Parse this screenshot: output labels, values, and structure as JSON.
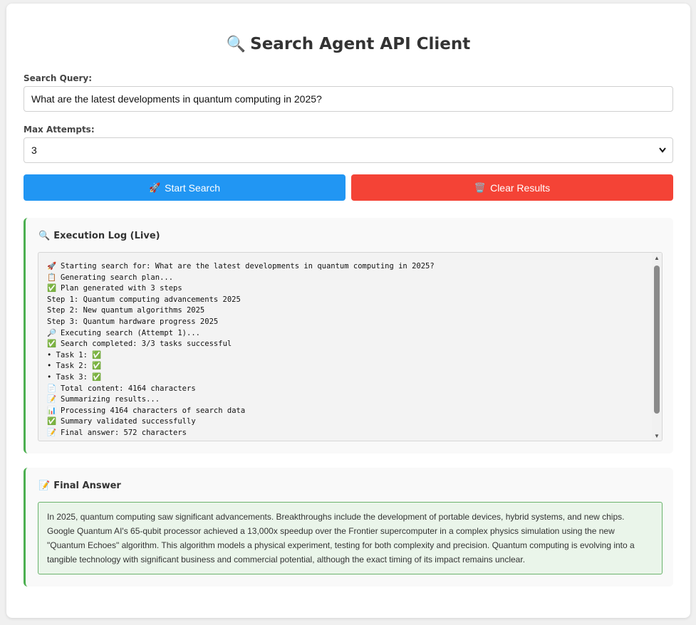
{
  "app": {
    "title": "Search Agent API Client",
    "title_icon": "🔍"
  },
  "form": {
    "query_label": "Search Query:",
    "query_value": "What are the latest developments in quantum computing in 2025?",
    "attempts_label": "Max Attempts:",
    "attempts_value": "3"
  },
  "buttons": {
    "start_icon": "🚀",
    "start_label": "Start Search",
    "clear_icon": "🗑️",
    "clear_label": "Clear Results"
  },
  "log": {
    "title_icon": "🔍",
    "title": "Execution Log (Live)",
    "lines": [
      {
        "icon": "🚀",
        "text": "Starting search for: What are the latest developments in quantum computing in 2025?"
      },
      {
        "icon": "📋",
        "text": "Generating search plan..."
      },
      {
        "icon": "✅",
        "text": "Plan generated with 3 steps"
      },
      {
        "icon": "",
        "text": "Step 1: Quantum computing advancements 2025"
      },
      {
        "icon": "",
        "text": "Step 2: New quantum algorithms 2025"
      },
      {
        "icon": "",
        "text": "Step 3: Quantum hardware progress 2025"
      },
      {
        "icon": "🔎",
        "text": "Executing search (Attempt 1)..."
      },
      {
        "icon": "✅",
        "text": "Search completed: 3/3 tasks successful"
      },
      {
        "icon": "",
        "text": "• Task 1: ✅"
      },
      {
        "icon": "",
        "text": "• Task 2: ✅"
      },
      {
        "icon": "",
        "text": "• Task 3: ✅"
      },
      {
        "icon": "📄",
        "text": "Total content: 4164 characters"
      },
      {
        "icon": "📝",
        "text": "Summarizing results..."
      },
      {
        "icon": "📊",
        "text": "Processing 4164 characters of search data"
      },
      {
        "icon": "✅",
        "text": "Summary validated successfully"
      },
      {
        "icon": "📝",
        "text": "Final answer: 572 characters"
      }
    ]
  },
  "answer": {
    "title_icon": "📝",
    "title": "Final Answer",
    "text": "In 2025, quantum computing saw significant advancements. Breakthroughs include the development of portable devices, hybrid systems, and new chips. Google Quantum AI's 65-qubit processor achieved a 13,000x speedup over the Frontier supercomputer in a complex physics simulation using the new \"Quantum Echoes\" algorithm. This algorithm models a physical experiment, testing for both complexity and precision. Quantum computing is evolving into a tangible technology with significant business and commercial potential, although the exact timing of its impact remains unclear."
  },
  "colors": {
    "start_button": "#2196F3",
    "clear_button": "#F44336",
    "panel_accent": "#4CAF50",
    "answer_bg": "#eaf5ea"
  }
}
